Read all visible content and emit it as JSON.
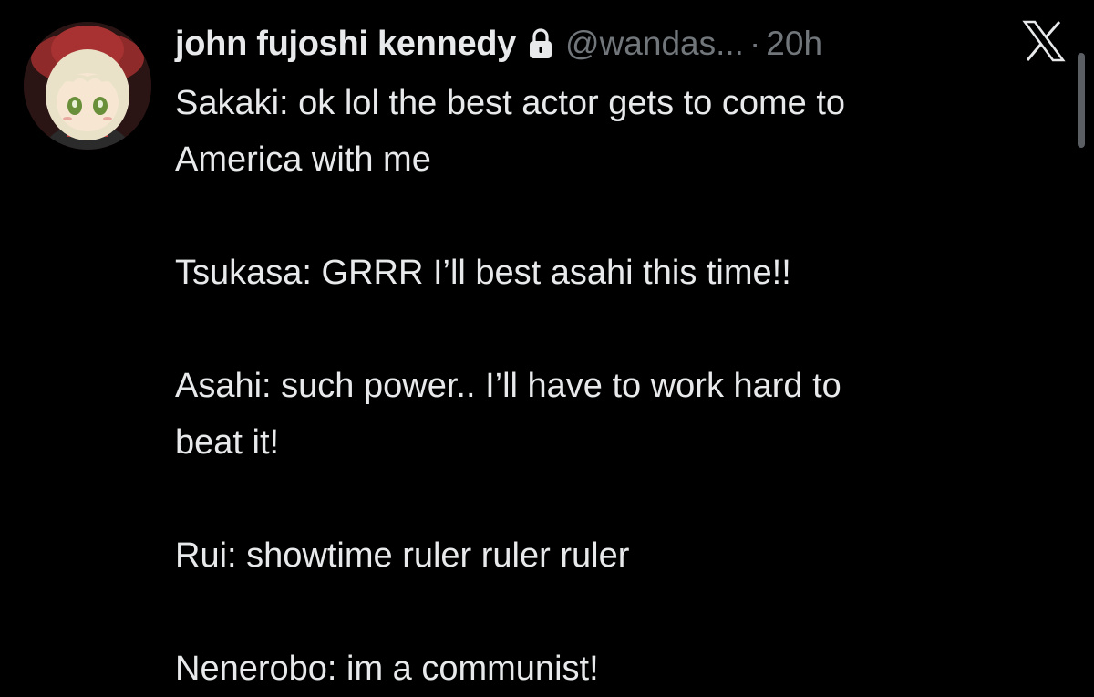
{
  "tweet": {
    "display_name": "john fujoshi kennedy",
    "handle": "@wandas...",
    "separator": "·",
    "time": "20h",
    "lines": [
      "Sakaki: ok lol the best actor gets to come to",
      "America with me",
      "Tsukasa: GRRR I’ll best asahi this time!!",
      "Asahi: such power.. I’ll have to work hard to",
      "beat it!",
      "Rui: showtime ruler ruler ruler",
      "Nenerobo: im a communist!"
    ]
  },
  "icons": {
    "lock": "lock-icon",
    "logo": "x-logo-icon",
    "avatar": "plush-avatar"
  },
  "colors": {
    "background": "#000000",
    "text_primary": "#e7e9ea",
    "text_secondary": "#71767b"
  }
}
